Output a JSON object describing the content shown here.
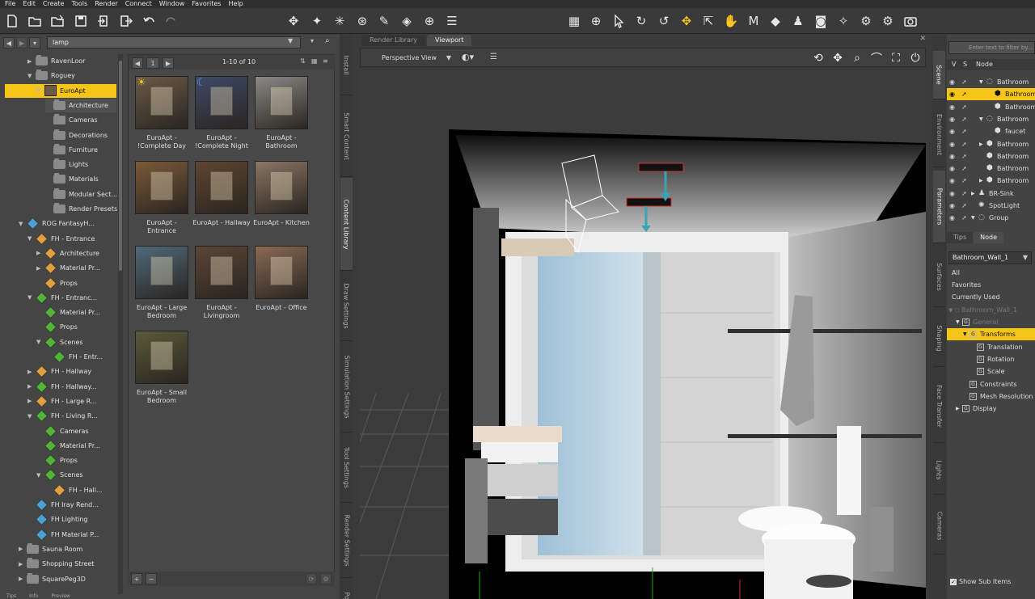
{
  "menu": [
    "File",
    "Edit",
    "Create",
    "Tools",
    "Render",
    "Connect",
    "Window",
    "Favorites",
    "Help"
  ],
  "content_library": {
    "search_value": "lamp",
    "page_label": "1",
    "range_label": "1-10 of 10",
    "tree": [
      {
        "label": "RavenLoor",
        "depth": 2,
        "arrow": "▶",
        "icon": "folder"
      },
      {
        "label": "Roguey",
        "depth": 2,
        "arrow": "▼",
        "icon": "folder"
      },
      {
        "label": "EuroApt",
        "depth": 3,
        "arrow": "▼",
        "icon": "thumb",
        "selected": true
      },
      {
        "label": "Architecture",
        "depth": 4,
        "arrow": "",
        "icon": "folder",
        "hover": true
      },
      {
        "label": "Cameras",
        "depth": 4,
        "arrow": "",
        "icon": "folder"
      },
      {
        "label": "Decorations",
        "depth": 4,
        "arrow": "",
        "icon": "folder"
      },
      {
        "label": "Furniture",
        "depth": 4,
        "arrow": "",
        "icon": "folder"
      },
      {
        "label": "Lights",
        "depth": 4,
        "arrow": "",
        "icon": "folder"
      },
      {
        "label": "Materials",
        "depth": 4,
        "arrow": "",
        "icon": "folder"
      },
      {
        "label": "Modular Sect...",
        "depth": 4,
        "arrow": "",
        "icon": "folder"
      },
      {
        "label": "Render Presets",
        "depth": 4,
        "arrow": "",
        "icon": "folder"
      },
      {
        "label": "ROG FantasyH...",
        "depth": 1,
        "arrow": "▼",
        "icon": "blue"
      },
      {
        "label": "FH - Entrance",
        "depth": 2,
        "arrow": "▼",
        "icon": "orange"
      },
      {
        "label": "Architecture",
        "depth": 3,
        "arrow": "▶",
        "icon": "orange"
      },
      {
        "label": "Material Pr...",
        "depth": 3,
        "arrow": "▶",
        "icon": "orange"
      },
      {
        "label": "Props",
        "depth": 3,
        "arrow": "",
        "icon": "orange"
      },
      {
        "label": "FH - Entranc...",
        "depth": 2,
        "arrow": "▼",
        "icon": "green"
      },
      {
        "label": "Material Pr...",
        "depth": 3,
        "arrow": "",
        "icon": "green"
      },
      {
        "label": "Props",
        "depth": 3,
        "arrow": "",
        "icon": "green"
      },
      {
        "label": "Scenes",
        "depth": 3,
        "arrow": "▼",
        "icon": "green"
      },
      {
        "label": "FH - Entr...",
        "depth": 4,
        "arrow": "",
        "icon": "green"
      },
      {
        "label": "FH - Hallway",
        "depth": 2,
        "arrow": "▶",
        "icon": "orange"
      },
      {
        "label": "FH - Hallway...",
        "depth": 2,
        "arrow": "▶",
        "icon": "green"
      },
      {
        "label": "FH - Large R...",
        "depth": 2,
        "arrow": "▶",
        "icon": "orange"
      },
      {
        "label": "FH - Living R...",
        "depth": 2,
        "arrow": "▼",
        "icon": "green"
      },
      {
        "label": "Cameras",
        "depth": 3,
        "arrow": "",
        "icon": "green"
      },
      {
        "label": "Material Pr...",
        "depth": 3,
        "arrow": "",
        "icon": "green"
      },
      {
        "label": "Props",
        "depth": 3,
        "arrow": "",
        "icon": "green"
      },
      {
        "label": "Scenes",
        "depth": 3,
        "arrow": "▼",
        "icon": "green"
      },
      {
        "label": "FH - Hall...",
        "depth": 4,
        "arrow": "",
        "icon": "orange"
      },
      {
        "label": "FH Iray Rend...",
        "depth": 2,
        "arrow": "",
        "icon": "blue"
      },
      {
        "label": "FH Lighting",
        "depth": 2,
        "arrow": "",
        "icon": "blue"
      },
      {
        "label": "FH Material P...",
        "depth": 2,
        "arrow": "",
        "icon": "blue"
      },
      {
        "label": "Sauna Room",
        "depth": 1,
        "arrow": "▶",
        "icon": "folder"
      },
      {
        "label": "Shopping Street",
        "depth": 1,
        "arrow": "▶",
        "icon": "folder"
      },
      {
        "label": "SquarePeg3D",
        "depth": 1,
        "arrow": "▶",
        "icon": "folder"
      }
    ],
    "tiles": [
      {
        "label": "EuroApt - !Complete Day",
        "tone": "#6a5a48",
        "badge": "sun"
      },
      {
        "label": "EuroApt - !Complete Night",
        "tone": "#3e4a66",
        "badge": "moon"
      },
      {
        "label": "EuroApt - Bathroom",
        "tone": "#8a8a86"
      },
      {
        "label": "EuroApt - Entrance",
        "tone": "#7a5a38"
      },
      {
        "label": "EuroApt - Hallway",
        "tone": "#5e4630"
      },
      {
        "label": "EuroApt - Kitchen",
        "tone": "#8a7664"
      },
      {
        "label": "EuroApt - Large Bedroom",
        "tone": "#4f6a7a"
      },
      {
        "label": "EuroApt - Livingroom",
        "tone": "#5a4636"
      },
      {
        "label": "EuroApt - Office",
        "tone": "#8a6a54"
      },
      {
        "label": "EuroApt - Small Bedroom",
        "tone": "#5a5a3a"
      }
    ]
  },
  "left_tabs": [
    "Install",
    "Smart Content",
    "Content Library",
    "Draw Settings",
    "Simulation Settings",
    "Tool Settings",
    "Render Settings",
    "Posing"
  ],
  "viewport": {
    "tabs": [
      "Render Library",
      "Viewport"
    ],
    "active_tab": "Viewport",
    "camera": "Perspective View"
  },
  "right_tabs": [
    "Scene",
    "Environment",
    "Parameters",
    "Surfaces",
    "Shaping",
    "Face Transfer",
    "Lights",
    "Cameras"
  ],
  "scene_panel": {
    "filter_placeholder": "Enter text to filter by...",
    "col_v": "V",
    "col_s": "S",
    "col_node": "Node",
    "rows": [
      {
        "label": "Bathroom",
        "indent": 1,
        "arrow": "▼",
        "kind": "group"
      },
      {
        "label": "Bathroom",
        "indent": 2,
        "arrow": "",
        "kind": "obj",
        "selected": true
      },
      {
        "label": "Bathroom",
        "indent": 2,
        "arrow": "",
        "kind": "obj"
      },
      {
        "label": "Bathroom",
        "indent": 1,
        "arrow": "▼",
        "kind": "group"
      },
      {
        "label": "faucet",
        "indent": 2,
        "arrow": "",
        "kind": "obj"
      },
      {
        "label": "Bathroom",
        "indent": 1,
        "arrow": "▶",
        "kind": "obj"
      },
      {
        "label": "Bathroom",
        "indent": 1,
        "arrow": "",
        "kind": "obj"
      },
      {
        "label": "Bathroom",
        "indent": 1,
        "arrow": "",
        "kind": "obj"
      },
      {
        "label": "Bathroom",
        "indent": 1,
        "arrow": "▶",
        "kind": "obj"
      },
      {
        "label": "BR-Sink",
        "indent": 0,
        "arrow": "▶",
        "kind": "figure"
      },
      {
        "label": "SpotLight",
        "indent": 0,
        "arrow": "",
        "kind": "light"
      },
      {
        "label": "Group",
        "indent": 0,
        "arrow": "▼",
        "kind": "group"
      }
    ]
  },
  "params_panel": {
    "tabs": [
      "Tips",
      "Node"
    ],
    "active_tab": "Node",
    "node_select": "Bathroom_Wall_1",
    "filters": [
      "All",
      "Favorites",
      "Currently Used"
    ],
    "root": "Bathroom_Wall_1",
    "items": [
      {
        "label": "General",
        "indent": 1,
        "arrow": "▼",
        "dim": true
      },
      {
        "label": "Transforms",
        "indent": 2,
        "arrow": "▼",
        "selected": true
      },
      {
        "label": "Translation",
        "indent": 3,
        "arrow": ""
      },
      {
        "label": "Rotation",
        "indent": 3,
        "arrow": ""
      },
      {
        "label": "Scale",
        "indent": 3,
        "arrow": ""
      },
      {
        "label": "Constraints",
        "indent": 2,
        "arrow": ""
      },
      {
        "label": "Mesh Resolution",
        "indent": 2,
        "arrow": ""
      },
      {
        "label": "Display",
        "indent": 1,
        "arrow": "▶"
      }
    ],
    "show_sub_items": "Show Sub Items"
  },
  "bottom_tabs": [
    "Tips",
    "Info",
    "Preview"
  ],
  "colors": {
    "accent": "#f5c518",
    "panel": "#454545",
    "dark": "#2e2e2e"
  }
}
